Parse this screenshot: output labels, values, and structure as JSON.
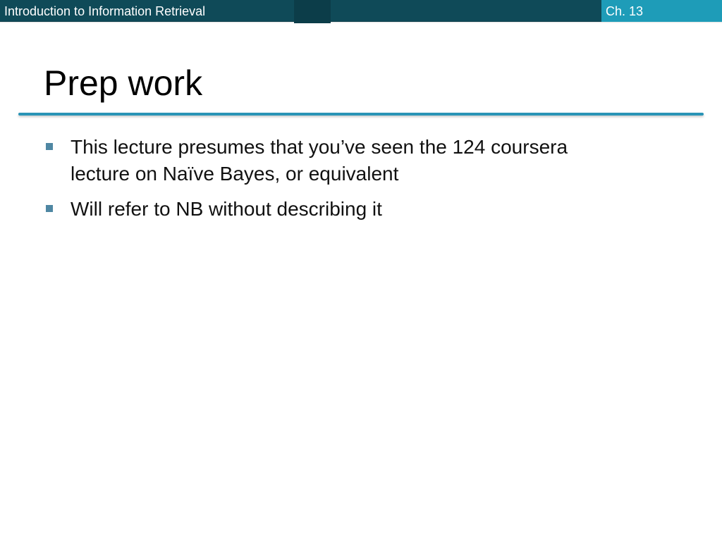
{
  "header": {
    "course_title": "Introduction to Information Retrieval",
    "chapter": "Ch. 13"
  },
  "slide": {
    "title": "Prep work",
    "bullets": [
      {
        "text": "This lecture presumes that you’ve seen the 124 coursera lecture on Naïve Bayes, or equivalent"
      },
      {
        "text": "Will refer to NB without describing it"
      }
    ]
  },
  "colors": {
    "header_dark": "#0f4a58",
    "header_accent": "#1e9cb8",
    "title_rule": "#2a94b6",
    "bullet_marker": "#4f87a3"
  }
}
